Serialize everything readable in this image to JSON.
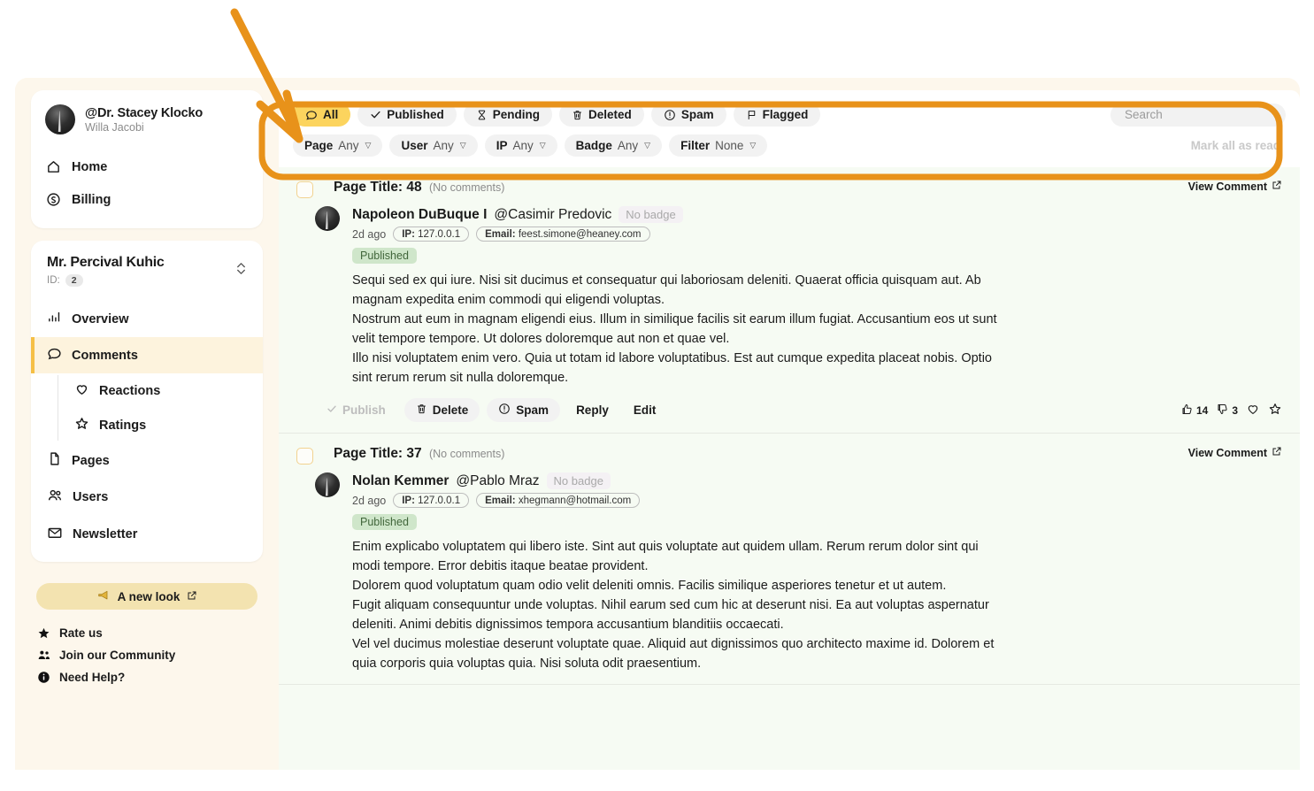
{
  "sidebar": {
    "profile": {
      "handle": "@Dr. Stacey Klocko",
      "subtitle": "Willa Jacobi"
    },
    "top_nav": [
      {
        "label": "Home",
        "icon": "home-icon"
      },
      {
        "label": "Billing",
        "icon": "dollar-circle-icon"
      }
    ],
    "section": {
      "title": "Mr. Percival Kuhic",
      "id_label": "ID:",
      "id_value": "2",
      "switcher_icon": "chevron-up-down-icon"
    },
    "nav": [
      {
        "label": "Overview",
        "icon": "bar-chart-icon",
        "active": false
      },
      {
        "label": "Comments",
        "icon": "chat-bubble-icon",
        "active": true
      },
      {
        "label": "Reactions",
        "icon": "heart-icon",
        "sub": true
      },
      {
        "label": "Ratings",
        "icon": "star-icon",
        "sub": true
      },
      {
        "label": "Pages",
        "icon": "document-icon",
        "active": false
      },
      {
        "label": "Users",
        "icon": "users-icon",
        "active": false
      },
      {
        "label": "Newsletter",
        "icon": "envelope-icon",
        "active": false
      }
    ],
    "promo": {
      "label": "A new look",
      "icon": "megaphone-icon",
      "external_icon": "external-link-icon"
    },
    "footer": [
      {
        "label": "Rate us",
        "icon": "star-filled-icon"
      },
      {
        "label": "Join our Community",
        "icon": "people-icon"
      },
      {
        "label": "Need Help?",
        "icon": "info-icon"
      }
    ]
  },
  "toolbar": {
    "status_filters": [
      {
        "label": "All",
        "icon": "chat-bubble-icon",
        "selected": true
      },
      {
        "label": "Published",
        "icon": "check-icon",
        "selected": false
      },
      {
        "label": "Pending",
        "icon": "hourglass-icon",
        "selected": false
      },
      {
        "label": "Deleted",
        "icon": "trash-icon",
        "selected": false
      },
      {
        "label": "Spam",
        "icon": "exclamation-circle-icon",
        "selected": false
      },
      {
        "label": "Flagged",
        "icon": "flag-icon",
        "selected": false
      }
    ],
    "dropdowns": [
      {
        "label": "Page",
        "value": "Any"
      },
      {
        "label": "User",
        "value": "Any"
      },
      {
        "label": "IP",
        "value": "Any"
      },
      {
        "label": "Badge",
        "value": "Any"
      },
      {
        "label": "Filter",
        "value": "None"
      }
    ],
    "search": {
      "placeholder": "Search",
      "value": ""
    },
    "mark_all_as_read": "Mark all as read"
  },
  "comments": [
    {
      "page_title": "Page Title: 48",
      "no_comments": "(No comments)",
      "view_comment": "View Comment",
      "author_name": "Napoleon DuBuque I",
      "author_handle": "@Casimir Predovic",
      "badge": "No badge",
      "time_ago": "2d ago",
      "ip_label": "IP:",
      "ip_value": "127.0.0.1",
      "email_label": "Email:",
      "email_value": "feest.simone@heaney.com",
      "status": "Published",
      "body": [
        "Sequi sed ex qui iure. Nisi sit ducimus et consequatur qui laboriosam deleniti. Quaerat officia quisquam aut. Ab magnam expedita enim commodi qui eligendi voluptas.",
        "Nostrum aut eum in magnam eligendi eius. Illum in similique facilis sit earum illum fugiat. Accusantium eos ut sunt velit tempore tempore. Ut dolores doloremque aut non et quae vel.",
        "Illo nisi voluptatem enim vero. Quia ut totam id labore voluptatibus. Est aut cumque expedita placeat nobis. Optio sint rerum rerum sit nulla doloremque."
      ],
      "actions": [
        {
          "label": "Publish",
          "icon": "check-icon",
          "style": "ghost"
        },
        {
          "label": "Delete",
          "icon": "trash-icon",
          "style": "filled"
        },
        {
          "label": "Spam",
          "icon": "exclamation-circle-icon",
          "style": "filled"
        },
        {
          "label": "Reply",
          "icon": "",
          "style": "plain"
        },
        {
          "label": "Edit",
          "icon": "",
          "style": "plain"
        }
      ],
      "reactions": {
        "thumbs_up_icon": "thumbs-up-icon",
        "thumbs_up": "14",
        "thumbs_down_icon": "thumbs-down-icon",
        "thumbs_down": "3",
        "heart_icon": "heart-icon",
        "star_icon": "star-icon"
      }
    },
    {
      "page_title": "Page Title: 37",
      "no_comments": "(No comments)",
      "view_comment": "View Comment",
      "author_name": "Nolan Kemmer",
      "author_handle": "@Pablo Mraz",
      "badge": "No badge",
      "time_ago": "2d ago",
      "ip_label": "IP:",
      "ip_value": "127.0.0.1",
      "email_label": "Email:",
      "email_value": "xhegmann@hotmail.com",
      "status": "Published",
      "body": [
        "Enim explicabo voluptatem qui libero iste. Sint aut quis voluptate aut quidem ullam. Rerum rerum dolor sint qui modi tempore. Error debitis itaque beatae provident.",
        "Dolorem quod voluptatum quam odio velit deleniti omnis. Facilis similique asperiores tenetur et ut autem.",
        "Fugit aliquam consequuntur unde voluptas. Nihil earum sed cum hic at deserunt nisi. Ea aut voluptas aspernatur deleniti. Animi debitis dignissimos tempora accusantium blanditiis occaecati.",
        "Vel vel ducimus molestiae deserunt voluptate quae. Aliquid aut dignissimos quo architecto maxime id. Dolorem et quia corporis quia voluptas quia. Nisi soluta odit praesentium."
      ],
      "actions": [],
      "reactions": null
    }
  ],
  "annotation": {
    "arrow_color": "#e8921a",
    "highlight_color": "#e8921a",
    "target": "toolbar"
  },
  "colors": {
    "accent_yellow": "#fcd45e",
    "sidebar_bg": "#fdf7ec",
    "list_bg": "#f6fbf3",
    "active_nav_bg": "#fdf3dd",
    "active_nav_bar": "#f5bf45",
    "status_published_bg": "#cfe6ca",
    "status_published_fg": "#41663b"
  }
}
